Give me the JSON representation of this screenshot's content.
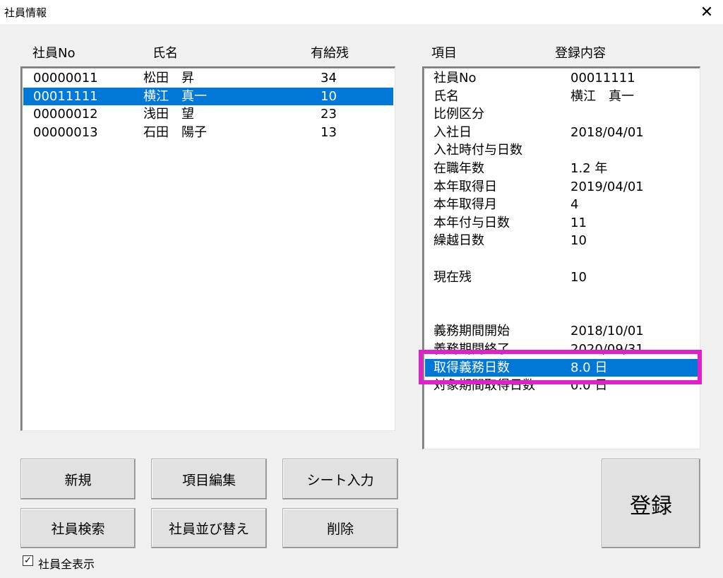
{
  "window": {
    "title": "社員情報",
    "close_glyph": "✕"
  },
  "employee_list": {
    "headers": [
      "社員No",
      "氏名",
      "有給残"
    ],
    "rows": [
      {
        "no": "00000011",
        "name": "松田　昇",
        "remaining": "34"
      },
      {
        "no": "00011111",
        "name": "横江　真一",
        "remaining": "10"
      },
      {
        "no": "00000012",
        "name": "浅田　望",
        "remaining": "23"
      },
      {
        "no": "00000013",
        "name": "石田　陽子",
        "remaining": "13"
      }
    ],
    "selected_index": 1
  },
  "detail_list": {
    "headers": [
      "項目",
      "登録内容"
    ],
    "rows": [
      {
        "item": "社員No",
        "value": "00011111"
      },
      {
        "item": "氏名",
        "value": "横江　真一"
      },
      {
        "item": "比例区分",
        "value": ""
      },
      {
        "item": "入社日",
        "value": "2018/04/01"
      },
      {
        "item": "入社時付与日数",
        "value": ""
      },
      {
        "item": "在職年数",
        "value": "1.2 年"
      },
      {
        "item": "本年取得日",
        "value": "2019/04/01"
      },
      {
        "item": "本年取得月",
        "value": "4"
      },
      {
        "item": "本年付与日数",
        "value": "11"
      },
      {
        "item": "繰越日数",
        "value": "10"
      },
      {
        "item": "",
        "value": ""
      },
      {
        "item": "現在残",
        "value": "10"
      },
      {
        "item": "",
        "value": ""
      },
      {
        "item": "",
        "value": ""
      },
      {
        "item": "義務期間開始",
        "value": "2018/10/01"
      },
      {
        "item": "義務期間終了",
        "value": "2020/09/31"
      },
      {
        "item": "取得義務日数",
        "value": "8.0 日"
      },
      {
        "item": "対象期間取得日数",
        "value": "0.0 日"
      }
    ],
    "selected_index": 16
  },
  "buttons": {
    "new": "新規",
    "edit_items": "項目編集",
    "sheet_input": "シート入力",
    "search": "社員検索",
    "sort": "社員並び替え",
    "delete": "削除",
    "register": "登録"
  },
  "show_all": {
    "label": "社員全表示",
    "checked": true,
    "check_glyph": "✓"
  },
  "colors": {
    "selection": "#0078d7",
    "annotation": "#e020c8"
  }
}
